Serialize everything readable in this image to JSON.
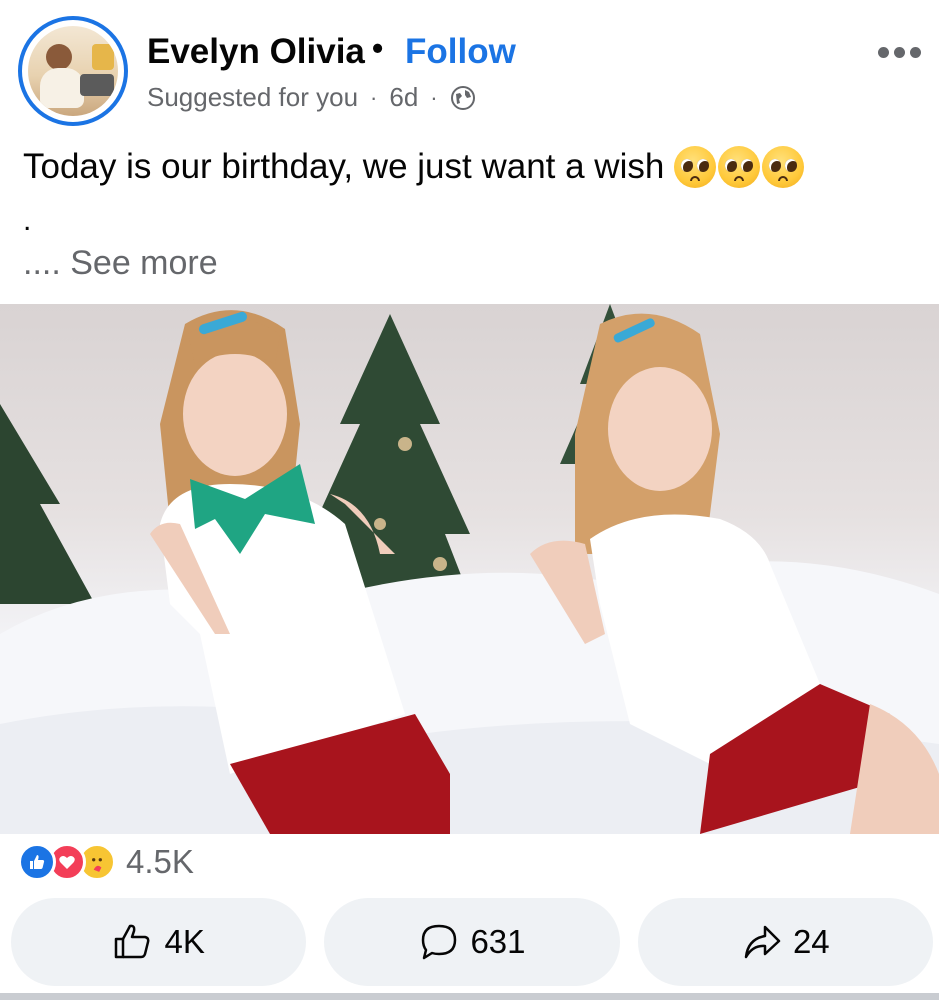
{
  "post": {
    "author": "Evelyn Olivia",
    "separator": "•",
    "follow_label": "Follow",
    "meta_suggested": "Suggested for you",
    "meta_dot": "·",
    "meta_time": "6d",
    "privacy_icon": "globe-icon",
    "more_icon": "more-options-icon",
    "text": "Today is our birthday, we just want a wish",
    "emoji": "🥺🥺🥺",
    "text_line2": ".",
    "see_more": ".... See more"
  },
  "reactions": {
    "icons": [
      "like-reaction-icon",
      "love-reaction-icon",
      "care-reaction-icon"
    ],
    "count": "4.5K"
  },
  "actions": {
    "like_count": "4K",
    "comment_count": "631",
    "share_count": "24"
  },
  "colors": {
    "brand_blue": "#1b74e4",
    "secondary_text": "#65676b",
    "button_bg": "#eff2f5"
  }
}
